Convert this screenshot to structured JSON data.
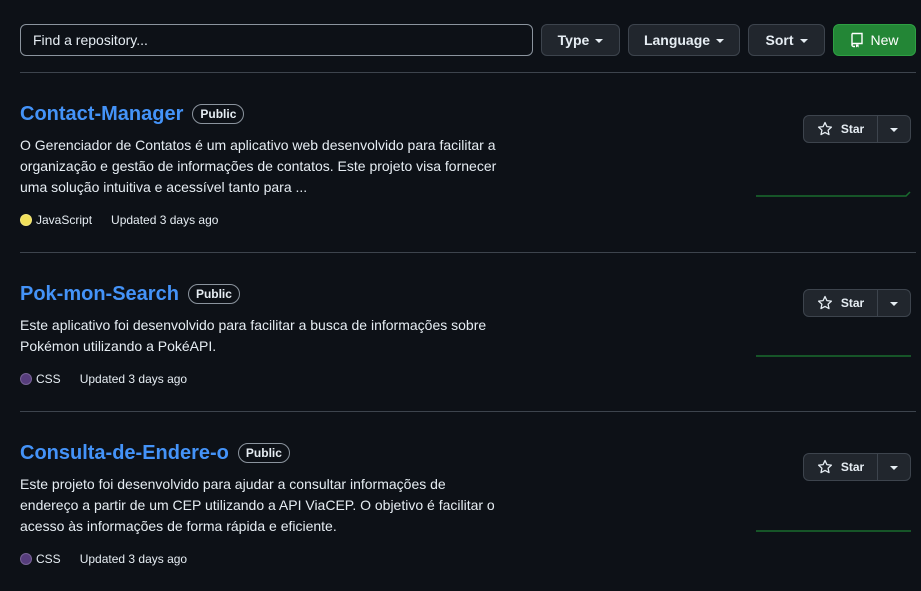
{
  "toolbar": {
    "search_placeholder": "Find a repository...",
    "type_label": "Type",
    "language_label": "Language",
    "sort_label": "Sort",
    "new_label": "New"
  },
  "colors": {
    "link": "#4493f8",
    "new_button": "#238636",
    "javascript": "#f1e05a",
    "css": "#563d7c",
    "sparkline": "#196c2e"
  },
  "repos": [
    {
      "name": "Contact-Manager",
      "visibility": "Public",
      "description": "O Gerenciador de Contatos é um aplicativo web desenvolvido para facilitar a organização e gestão de informações de contatos. Este projeto visa fornecer uma solução intuitiva e acessível tanto para ...",
      "language": "JavaScript",
      "updated": "Updated 3 days ago",
      "star_label": "Star"
    },
    {
      "name": "Pok-mon-Search",
      "visibility": "Public",
      "description": "Este aplicativo foi desenvolvido para facilitar a busca de informações sobre Pokémon utilizando a PokéAPI.",
      "language": "CSS",
      "updated": "Updated 3 days ago",
      "star_label": "Star"
    },
    {
      "name": "Consulta-de-Endere-o",
      "visibility": "Public",
      "description": "Este projeto foi desenvolvido para ajudar a consultar informações de endereço a partir de um CEP utilizando a API ViaCEP. O objetivo é facilitar o acesso às informações de forma rápida e eficiente.",
      "language": "CSS",
      "updated": "Updated 3 days ago",
      "star_label": "Star"
    }
  ]
}
